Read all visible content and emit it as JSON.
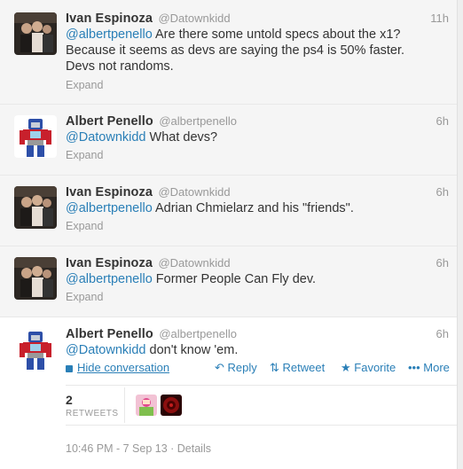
{
  "tweets": [
    {
      "name": "Ivan Espinoza",
      "handle": "@Datownkidd",
      "time": "11h",
      "mention": "@albertpenello",
      "text": " Are there some untold specs about the x1? Because it seems as devs are saying the ps4 is 50% faster. Devs not randoms.",
      "expand": "Expand"
    },
    {
      "name": "Albert Penello",
      "handle": "@albertpenello",
      "time": "6h",
      "mention": "@Datownkidd",
      "text": " What devs?",
      "expand": "Expand"
    },
    {
      "name": "Ivan Espinoza",
      "handle": "@Datownkidd",
      "time": "6h",
      "mention": "@albertpenello",
      "text": " Adrian Chmielarz and his \"friends\".",
      "expand": "Expand"
    },
    {
      "name": "Ivan Espinoza",
      "handle": "@Datownkidd",
      "time": "6h",
      "mention": "@albertpenello",
      "text": " Former People Can Fly dev.",
      "expand": "Expand"
    },
    {
      "name": "Albert Penello",
      "handle": "@albertpenello",
      "time": "6h",
      "mention": "@Datownkidd",
      "text": " don't know 'em.",
      "hide_conversation": "Hide conversation",
      "actions": {
        "reply": "Reply",
        "retweet": "Retweet",
        "favorite": "Favorite",
        "more": "More"
      },
      "retweet_count": "2",
      "retweet_label": "RETWEETS",
      "footer": "10:46 PM - 7 Sep 13 · Details"
    }
  ],
  "colors": {
    "link": "#2a7fb7",
    "muted": "#999999",
    "text": "#333333",
    "collapsed_bg": "#f5f5f5"
  },
  "icons": [
    "avatar-ivan",
    "avatar-albert",
    "conversation-icon",
    "reply-icon",
    "retweet-icon",
    "favorite-icon",
    "more-icon"
  ]
}
